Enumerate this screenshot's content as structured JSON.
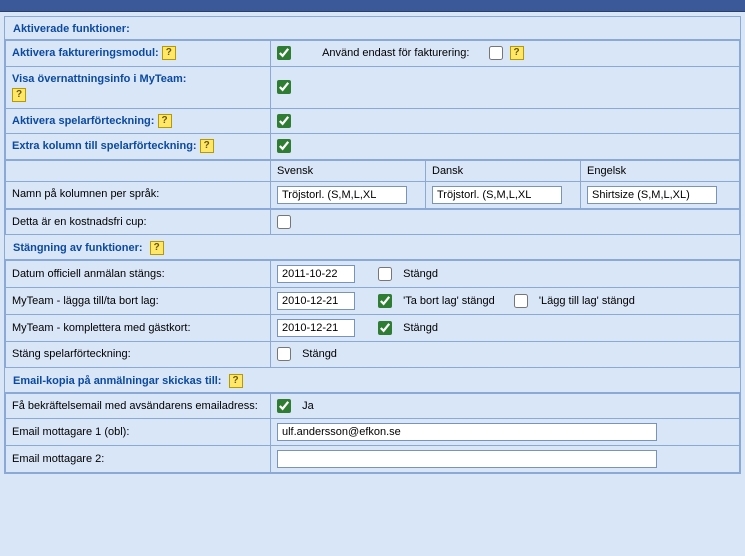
{
  "sections": {
    "activated": {
      "title": "Aktiverade funktioner:",
      "rows": {
        "invoice_module": {
          "label": "Aktivera faktureringsmodul:",
          "checked": true,
          "only_invoice_label": "Använd endast för fakturering:",
          "only_invoice_checked": false
        },
        "overnight_info": {
          "label": "Visa övernattningsinfo i MyTeam:",
          "checked": true
        },
        "player_list": {
          "label": "Aktivera spelarförteckning:",
          "checked": true
        },
        "extra_column": {
          "label": "Extra kolumn till spelarförteckning:",
          "checked": true
        },
        "lang_headers": {
          "sv": "Svensk",
          "da": "Dansk",
          "en": "Engelsk"
        },
        "column_name": {
          "label": "Namn på kolumnen per språk:",
          "sv_value": "Tröjstorl. (S,M,L,XL",
          "da_value": "Tröjstorl. (S,M,L,XL",
          "en_value": "Shirtsize (S,M,L,XL)"
        },
        "free_cup": {
          "label": "Detta är en kostnadsfri cup:",
          "checked": false
        }
      }
    },
    "closing": {
      "title": "Stängning av funktioner:",
      "rows": {
        "official_reg": {
          "label": "Datum officiell anmälan stängs:",
          "date": "2011-10-22",
          "closed_label": "Stängd",
          "closed_checked": false
        },
        "myteam_addremove": {
          "label": "MyTeam - lägga till/ta bort lag:",
          "date": "2010-12-21",
          "remove_label": "'Ta bort lag' stängd",
          "remove_checked": true,
          "add_label": "'Lägg till lag' stängd",
          "add_checked": false
        },
        "myteam_guest": {
          "label": "MyTeam - komplettera med gästkort:",
          "date": "2010-12-21",
          "closed_label": "Stängd",
          "closed_checked": true
        },
        "close_playerlist": {
          "label": "Stäng spelarförteckning:",
          "closed_label": "Stängd",
          "closed_checked": false
        }
      }
    },
    "emailcopy": {
      "title": "Email-kopia på anmälningar skickas till:",
      "rows": {
        "confirm_sender": {
          "label": "Få bekräftelsemail med avsändarens emailadress:",
          "checked": true,
          "yes_label": "Ja"
        },
        "recipient1": {
          "label": "Email mottagare 1 (obl):",
          "value": "ulf.andersson@efkon.se"
        },
        "recipient2": {
          "label": "Email mottagare 2:",
          "value": ""
        }
      }
    }
  }
}
